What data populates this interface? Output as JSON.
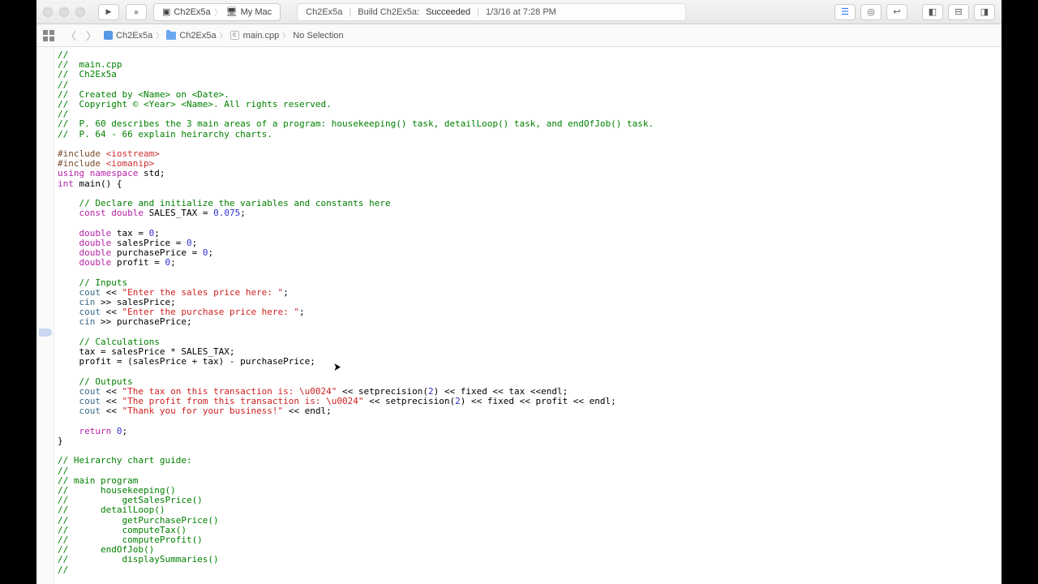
{
  "toolbar": {
    "scheme_target": "Ch2Ex5a",
    "scheme_device": "My Mac"
  },
  "status": {
    "project": "Ch2Ex5a",
    "action": "Build Ch2Ex5a:",
    "result": "Succeeded",
    "timestamp": "1/3/16 at 7:28 PM"
  },
  "jumpbar": {
    "project": "Ch2Ex5a",
    "folder": "Ch2Ex5a",
    "file": "main.cpp",
    "selection": "No Selection"
  },
  "code": {
    "lines": [
      {
        "t": "comment",
        "s": "//"
      },
      {
        "t": "comment",
        "s": "//  main.cpp"
      },
      {
        "t": "comment",
        "s": "//  Ch2Ex5a"
      },
      {
        "t": "comment",
        "s": "//"
      },
      {
        "t": "comment",
        "s": "//  Created by <Name> on <Date>."
      },
      {
        "t": "comment",
        "s": "//  Copyright © <Year> <Name>. All rights reserved."
      },
      {
        "t": "comment",
        "s": "//"
      },
      {
        "t": "comment",
        "s": "//  P. 60 describes the 3 main areas of a program: housekeeping() task, detailLoop() task, and endOfJob() task."
      },
      {
        "t": "comment",
        "s": "//  P. 64 - 66 explain heirarchy charts."
      },
      {
        "t": "blank",
        "s": ""
      },
      {
        "t": "include",
        "pre": "#include ",
        "hdr": "<iostream>"
      },
      {
        "t": "include",
        "pre": "#include ",
        "hdr": "<iomanip>"
      },
      {
        "t": "using",
        "kw": "using namespace",
        "rest": " std;"
      },
      {
        "t": "main",
        "kw": "int",
        "rest": " main() {"
      },
      {
        "t": "blank",
        "s": ""
      },
      {
        "t": "comment",
        "s": "    // Declare and initialize the variables and constants here"
      },
      {
        "t": "decl",
        "indent": "    ",
        "kw": "const double",
        "name": " SALES_TAX = ",
        "num": "0.075",
        "end": ";"
      },
      {
        "t": "blank",
        "s": ""
      },
      {
        "t": "decl",
        "indent": "    ",
        "kw": "double",
        "name": " tax = ",
        "num": "0",
        "end": ";"
      },
      {
        "t": "decl",
        "indent": "    ",
        "kw": "double",
        "name": " salesPrice = ",
        "num": "0",
        "end": ";"
      },
      {
        "t": "decl",
        "indent": "    ",
        "kw": "double",
        "name": " purchasePrice = ",
        "num": "0",
        "end": ";"
      },
      {
        "t": "decl",
        "indent": "    ",
        "kw": "double",
        "name": " profit = ",
        "num": "0",
        "end": ";"
      },
      {
        "t": "blank",
        "s": ""
      },
      {
        "t": "comment",
        "s": "    // Inputs"
      },
      {
        "t": "io",
        "indent": "    ",
        "obj": "cout",
        "op": " << ",
        "str": "\"Enter the sales price here: \"",
        "end": ";"
      },
      {
        "t": "cin",
        "indent": "    ",
        "obj": "cin",
        "rest": " >> salesPrice;"
      },
      {
        "t": "io",
        "indent": "    ",
        "obj": "cout",
        "op": " << ",
        "str": "\"Enter the purchase price here: \"",
        "end": ";"
      },
      {
        "t": "cin",
        "indent": "    ",
        "obj": "cin",
        "rest": " >> purchasePrice;"
      },
      {
        "t": "blank",
        "s": ""
      },
      {
        "t": "comment",
        "s": "    // Calculations"
      },
      {
        "t": "plain",
        "s": "    tax = salesPrice * SALES_TAX;"
      },
      {
        "t": "plain",
        "s": "    profit = (salesPrice + tax) - purchasePrice;"
      },
      {
        "t": "blank",
        "s": ""
      },
      {
        "t": "comment",
        "s": "    // Outputs"
      },
      {
        "t": "io2",
        "indent": "    ",
        "obj": "cout",
        "op": " << ",
        "str": "\"The tax on this transaction is: \\u0024\"",
        "rest": " << setprecision(",
        "num": "2",
        "rest2": ") << fixed << tax <<endl;"
      },
      {
        "t": "io2",
        "indent": "    ",
        "obj": "cout",
        "op": " << ",
        "str": "\"The profit from this transaction is: \\u0024\"",
        "rest": " << setprecision(",
        "num": "2",
        "rest2": ") << fixed << profit << endl;"
      },
      {
        "t": "io",
        "indent": "    ",
        "obj": "cout",
        "op": " << ",
        "str": "\"Thank you for your business!\"",
        "end": " << endl;"
      },
      {
        "t": "blank",
        "s": ""
      },
      {
        "t": "return",
        "indent": "    ",
        "kw": "return",
        "sp": " ",
        "num": "0",
        "end": ";"
      },
      {
        "t": "plain",
        "s": "}"
      },
      {
        "t": "blank",
        "s": ""
      },
      {
        "t": "comment",
        "s": "// Heirarchy chart guide:"
      },
      {
        "t": "comment",
        "s": "//"
      },
      {
        "t": "comment",
        "s": "// main program"
      },
      {
        "t": "comment",
        "s": "//      housekeeping()"
      },
      {
        "t": "comment",
        "s": "//          getSalesPrice()"
      },
      {
        "t": "comment",
        "s": "//      detailLoop()"
      },
      {
        "t": "comment",
        "s": "//          getPurchasePrice()"
      },
      {
        "t": "comment",
        "s": "//          computeTax()"
      },
      {
        "t": "comment",
        "s": "//          computeProfit()"
      },
      {
        "t": "comment",
        "s": "//      endOfJob()"
      },
      {
        "t": "comment",
        "s": "//          displaySummaries()"
      },
      {
        "t": "comment",
        "s": "//"
      }
    ]
  },
  "gutter_mark_line": 29
}
